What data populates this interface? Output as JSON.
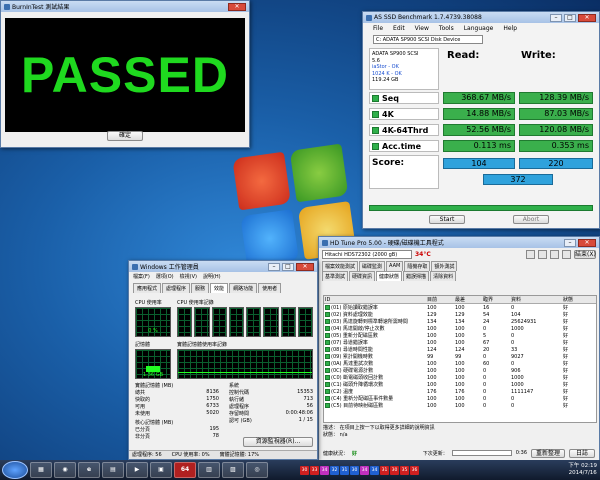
{
  "burnin": {
    "title": "BurnInTest 測試結果",
    "result": "PASSED",
    "ok": "確定"
  },
  "asssd": {
    "title": "AS SSD Benchmark 1.7.4739.38088",
    "menu": [
      "File",
      "Edit",
      "View",
      "Tools",
      "Language",
      "Help"
    ],
    "drive_select": "C: ADATA SP900 SCSI Disk Device",
    "info": {
      "line1": "ADATA SP900 SCSI",
      "line2": "5.6",
      "line3": "iaStor - OK",
      "line4": "1024 K - OK",
      "line5": "119.24 GB"
    },
    "read_label": "Read:",
    "write_label": "Write:",
    "rows": [
      {
        "label": "Seq",
        "read": "368.67 MB/s",
        "write": "128.39 MB/s"
      },
      {
        "label": "4K",
        "read": "14.88 MB/s",
        "write": "87.03 MB/s"
      },
      {
        "label": "4K-64Thrd",
        "read": "52.56 MB/s",
        "write": "120.08 MB/s"
      },
      {
        "label": "Acc.time",
        "read": "0.113 ms",
        "write": "0.353 ms"
      }
    ],
    "score_label": "Score:",
    "score_read": "104",
    "score_write": "220",
    "score_total": "372",
    "start": "Start",
    "abort": "Abort",
    "progress_fraction": 1.0
  },
  "taskman": {
    "title": "Windows 工作管理員",
    "menu": [
      "檔案(F)",
      "選項(O)",
      "檢視(V)",
      "說明(H)"
    ],
    "tabs": [
      "應用程式",
      "處理程序",
      "服務",
      "效能",
      "網路功能",
      "使用者"
    ],
    "active_tab": "效能",
    "cpu_usage_label": "CPU 使用率",
    "cpu_usage_value": "0 %",
    "cpu_history_label": "CPU 使用率記錄",
    "mem_label": "記憶體",
    "mem_value": "1.36 GB",
    "mem_history_label": "實體記憶體使用率記錄",
    "phys_header": "實體記憶體 (MB)",
    "phys": [
      [
        "總共",
        "8136"
      ],
      [
        "快取的",
        "1750"
      ],
      [
        "可用",
        "6733"
      ],
      [
        "未使用",
        "5020"
      ]
    ],
    "sys_header": "系統",
    "sys": [
      [
        "控制代碼",
        "15353"
      ],
      [
        "執行緒",
        "713"
      ],
      [
        "處理程序",
        "56"
      ],
      [
        "存留時間",
        "0:00:48:06"
      ],
      [
        "認可 (GB)",
        "1 / 15"
      ]
    ],
    "kernel_header": "核心記憶體 (MB)",
    "kernel": [
      [
        "已分頁",
        "195"
      ],
      [
        "非分頁",
        "78"
      ]
    ],
    "resmon_button": "資源監視器(R)...",
    "status": [
      "處理程序: 56",
      "CPU 使用率: 0%",
      "實體記憶體: 17%"
    ]
  },
  "hdtune": {
    "title": "HD Tune Pro 5.00 - 硬碟/磁碟機工具程式",
    "drive": "Hitachi HDS72302 (2000 gB)",
    "temp": "34°C",
    "exit": "結束(X)",
    "tabs_row1": [
      "檔案效能測試",
      "磁碟監測",
      "AAM",
      "隨機存取",
      "額外測試"
    ],
    "tabs_row2": [
      "基準測試",
      "硬碟資訊",
      "健康狀態",
      "錯誤掃描",
      "清除資料"
    ],
    "columns": [
      "ID",
      "目前",
      "最差",
      "臨界",
      "資料",
      "狀態"
    ],
    "rows": [
      [
        "(01) 原始讀取錯誤率",
        "100",
        "100",
        "16",
        "0",
        "好"
      ],
      [
        "(02) 資料處理效能",
        "129",
        "129",
        "54",
        "104",
        "好"
      ],
      [
        "(03) 馬達旋轉到標準轉速所需時間",
        "134",
        "134",
        "24",
        "25624931",
        "好"
      ],
      [
        "(04) 馬達開啟/停止次數",
        "100",
        "100",
        "0",
        "1000",
        "好"
      ],
      [
        "(05) 重新分配磁區數",
        "100",
        "100",
        "5",
        "0",
        "好"
      ],
      [
        "(07) 尋道錯誤率",
        "100",
        "100",
        "67",
        "0",
        "好"
      ],
      [
        "(08) 尋道時間性能",
        "124",
        "124",
        "20",
        "33",
        "好"
      ],
      [
        "(09) 累計開機時數",
        "99",
        "99",
        "0",
        "9027",
        "好"
      ],
      [
        "(0A) 馬達重試次數",
        "100",
        "100",
        "60",
        "0",
        "好"
      ],
      [
        "(0C) 硬碟電源計數",
        "100",
        "100",
        "0",
        "906",
        "好"
      ],
      [
        "(C0) 斷電磁頭收回計數",
        "100",
        "100",
        "0",
        "1000",
        "好"
      ],
      [
        "(C1) 磁頭升降循環次數",
        "100",
        "100",
        "0",
        "1000",
        "好"
      ],
      [
        "(C2) 溫度",
        "176",
        "176",
        "0",
        "1111147",
        "好"
      ],
      [
        "(C4) 重新分配磁區事件數量",
        "100",
        "100",
        "0",
        "0",
        "好"
      ],
      [
        "(C5) 目前待映射磁區數",
        "100",
        "100",
        "0",
        "0",
        "好"
      ]
    ],
    "desc_label": "描述：",
    "desc_text": "在項目上按一下以取得更多詳細的說明資訊",
    "status_label": "狀態：",
    "status_text": "n/a",
    "health_label": "健康狀況：",
    "health_value": "好",
    "next_update_label": "下次更新：",
    "next_update_value": "0:36",
    "refresh": "重新整理",
    "log": "日誌"
  },
  "taskbar": {
    "app_badge": "64",
    "tray_numbers": [
      "30",
      "33",
      "34",
      "32",
      "31",
      "30",
      "34",
      "34",
      "31",
      "30",
      "35",
      "36"
    ],
    "tray_colors": [
      "#d02020",
      "#d02020",
      "#c030c0",
      "#2060d0",
      "#2060d0",
      "#2060d0",
      "#c030c0",
      "#2060d0",
      "#d02020",
      "#d02020",
      "#d02020",
      "#d02020"
    ],
    "time": "下午 02:19",
    "date": "2014/7/16"
  }
}
